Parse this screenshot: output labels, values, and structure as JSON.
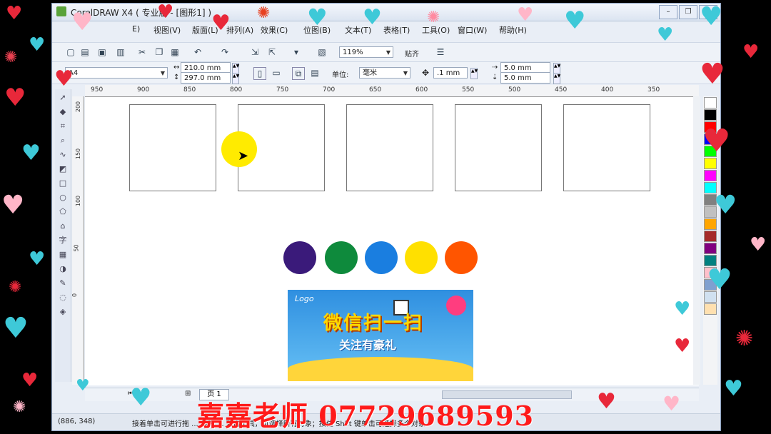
{
  "window": {
    "title": "CorelDRAW X4 ( 专业版 - [图形1] )",
    "buttons": [
      "–",
      "❐",
      "✕"
    ]
  },
  "menu": {
    "items": [
      {
        "label": "E)"
      },
      {
        "label": "视图(V)"
      },
      {
        "label": "版面(L)"
      },
      {
        "label": "排列(A)"
      },
      {
        "label": "效果(C)"
      },
      {
        "label": "位图(B)"
      },
      {
        "label": "文本(T)"
      },
      {
        "label": "表格(T)"
      },
      {
        "label": "工具(O)"
      },
      {
        "label": "窗口(W)"
      },
      {
        "label": "帮助(H)"
      }
    ]
  },
  "toolbar1": {
    "zoom": "119%",
    "snap": "贴齐"
  },
  "toolbar2": {
    "paper": "A4",
    "width": "210.0 mm",
    "height": "297.0 mm",
    "unit_label": "单位:",
    "unit": "毫米",
    "nudge": ".1 mm",
    "dup_x": "5.0 mm",
    "dup_y": "5.0 mm"
  },
  "ruler": {
    "h_ticks": [
      "950",
      "900",
      "850",
      "800",
      "750",
      "700",
      "650",
      "600",
      "550",
      "500",
      "450",
      "400",
      "350"
    ],
    "v_ticks": [
      "200",
      "150",
      "100",
      "50",
      "0"
    ]
  },
  "canvas": {
    "frames": 5,
    "swatches": [
      "#3a1a7a",
      "#0e8a3c",
      "#1a7ee0",
      "#ffe000",
      "#ff5500"
    ],
    "banner": {
      "logo": "Logo",
      "headline1": "微信扫一扫",
      "headline2": "关注有豪礼"
    }
  },
  "palette": {
    "colors": [
      "#ffffff",
      "#000000",
      "#ff0000",
      "#0000ff",
      "#00ff00",
      "#ffff00",
      "#ff00ff",
      "#00ffff",
      "#808080",
      "#c0c0c0",
      "#ffa500",
      "#a52a2a",
      "#800080",
      "#008080",
      "#ffc0cb",
      "#7fa0d0",
      "#d0e0f0",
      "#ffe0b0"
    ]
  },
  "pagebar": {
    "page_tab": "页 1"
  },
  "statusbar": {
    "coords": "(886, 348)",
    "hint": "接着单击可进行拖 ... 旋转 ... 双击工具，可选择所有对象；按住 Shift 键单击可选择多个对象"
  },
  "watermark": "嘉嘉老师 07729689593"
}
